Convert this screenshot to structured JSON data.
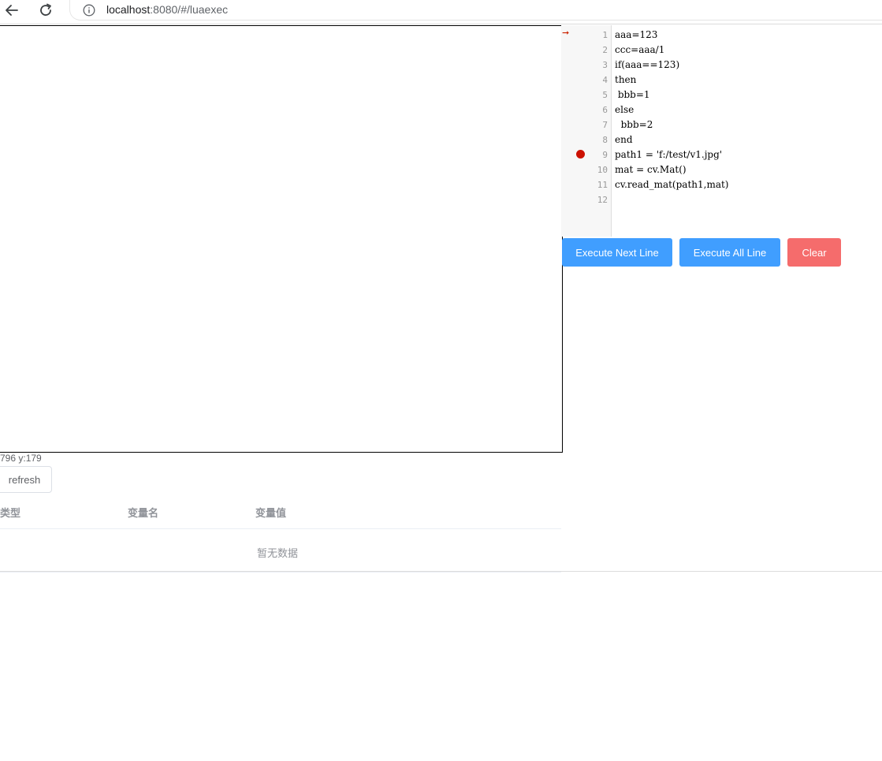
{
  "browser": {
    "url_host": "localhost",
    "url_rest": ":8080/#/luaexec"
  },
  "status": {
    "coordinates": "796 y:179"
  },
  "toolbar": {
    "refresh_label": "refresh"
  },
  "variables_table": {
    "columns": [
      "类型",
      "变量名",
      "变量值"
    ],
    "empty_text": "暂无数据"
  },
  "editor": {
    "current_line": 1,
    "breakpoint_line": 9,
    "lines": [
      {
        "no": "1",
        "code": "aaa=123"
      },
      {
        "no": "2",
        "code": "ccc=aaa/1"
      },
      {
        "no": "3",
        "code": "if(aaa==123)"
      },
      {
        "no": "4",
        "code": "then"
      },
      {
        "no": "5",
        "code": " bbb=1"
      },
      {
        "no": "6",
        "code": "else"
      },
      {
        "no": "7",
        "code": "  bbb=2"
      },
      {
        "no": "8",
        "code": "end"
      },
      {
        "no": "9",
        "code": "path1 = 'f:/test/v1.jpg'"
      },
      {
        "no": "10",
        "code": "mat = cv.Mat()"
      },
      {
        "no": "11",
        "code": "cv.read_mat(path1,mat)"
      },
      {
        "no": "12",
        "code": ""
      }
    ]
  },
  "actions": {
    "execute_next_label": "Execute Next Line",
    "execute_all_label": "Execute All Line",
    "clear_label": "Clear"
  },
  "colors": {
    "primary": "#409eff",
    "danger": "#f56c6c",
    "breakpoint": "#cc1100"
  }
}
